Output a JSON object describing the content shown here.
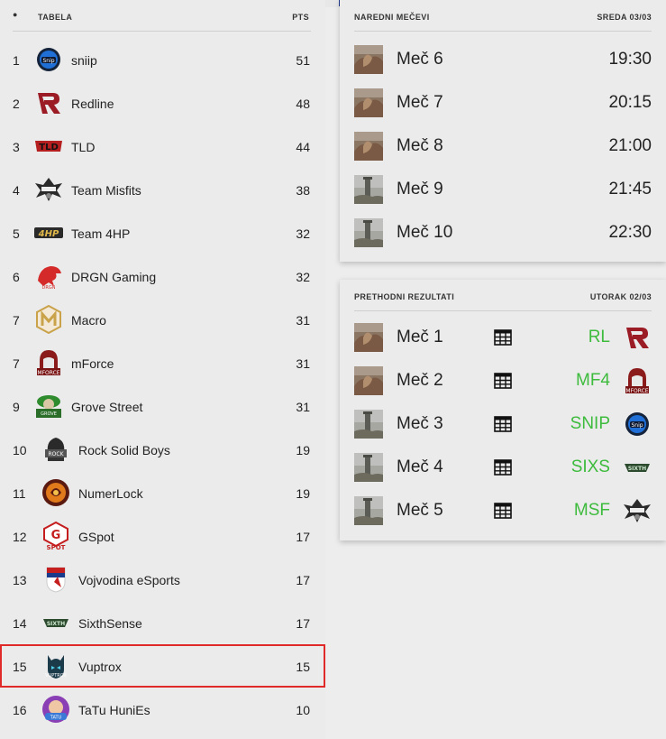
{
  "standings": {
    "header_dot": "●",
    "title": "TABELA",
    "pts_label": "PTS",
    "rows": [
      {
        "rank": "1",
        "team": "sniip",
        "pts": "51",
        "logo": "sniip-logo"
      },
      {
        "rank": "2",
        "team": "Redline",
        "pts": "48",
        "logo": "redline-logo"
      },
      {
        "rank": "3",
        "team": "TLD",
        "pts": "44",
        "logo": "tld-logo"
      },
      {
        "rank": "4",
        "team": "Team Misfits",
        "pts": "38",
        "logo": "misfits-logo"
      },
      {
        "rank": "5",
        "team": "Team 4HP",
        "pts": "32",
        "logo": "4hp-logo"
      },
      {
        "rank": "6",
        "team": "DRGN Gaming",
        "pts": "32",
        "logo": "drgn-logo"
      },
      {
        "rank": "7",
        "team": "Macro",
        "pts": "31",
        "logo": "macro-logo"
      },
      {
        "rank": "7",
        "team": "mForce",
        "pts": "31",
        "logo": "mforce-logo"
      },
      {
        "rank": "9",
        "team": "Grove Street",
        "pts": "31",
        "logo": "grove-street-logo"
      },
      {
        "rank": "10",
        "team": "Rock Solid Boys",
        "pts": "19",
        "logo": "rock-solid-logo"
      },
      {
        "rank": "11",
        "team": "NumerLock",
        "pts": "19",
        "logo": "numerlock-logo"
      },
      {
        "rank": "12",
        "team": "GSpot",
        "pts": "17",
        "logo": "gspot-logo"
      },
      {
        "rank": "13",
        "team": "Vojvodina eSports",
        "pts": "17",
        "logo": "vojvodina-logo"
      },
      {
        "rank": "14",
        "team": "SixthSense",
        "pts": "17",
        "logo": "sixthsense-logo"
      },
      {
        "rank": "15",
        "team": "Vuptrox",
        "pts": "15",
        "logo": "vuptrox-logo"
      },
      {
        "rank": "16",
        "team": "TaTu HuniEs",
        "pts": "10",
        "logo": "tatu-logo"
      }
    ]
  },
  "upcoming": {
    "title": "NAREDNI MEČEVI",
    "date": "SREDA 03/03",
    "matches": [
      {
        "name": "Meč 6",
        "time": "19:30",
        "map": "desert"
      },
      {
        "name": "Meč 7",
        "time": "20:15",
        "map": "desert"
      },
      {
        "name": "Meč 8",
        "time": "21:00",
        "map": "desert"
      },
      {
        "name": "Meč 9",
        "time": "21:45",
        "map": "tower"
      },
      {
        "name": "Meč 10",
        "time": "22:30",
        "map": "tower"
      }
    ]
  },
  "results": {
    "title": "PRETHODNI REZULTATI",
    "date": "UTORAK 02/03",
    "matches": [
      {
        "name": "Meč 1",
        "winner": "RL",
        "map": "desert",
        "logo": "redline-logo"
      },
      {
        "name": "Meč 2",
        "winner": "MF4",
        "map": "desert",
        "logo": "mforce-logo"
      },
      {
        "name": "Meč 3",
        "winner": "SNIP",
        "map": "tower",
        "logo": "sniip-logo"
      },
      {
        "name": "Meč 4",
        "winner": "SIXS",
        "map": "tower",
        "logo": "sixthsense-logo"
      },
      {
        "name": "Meč 5",
        "winner": "MSF",
        "map": "tower",
        "logo": "misfits-logo"
      }
    ]
  },
  "colors": {
    "highlight_border": "#e02a2a",
    "winner_text": "#3dbb3d",
    "accent_blue": "#203a8c"
  },
  "icons": {
    "table_icon": "grid-table-icon"
  }
}
